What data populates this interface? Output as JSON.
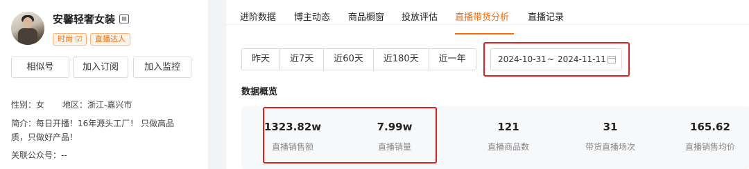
{
  "profile": {
    "shop_name": "安馨轻奢女装",
    "tags": [
      "时尚 ☑",
      "直播达人"
    ],
    "buttons": [
      "相似号",
      "加入订阅",
      "加入监控"
    ],
    "gender": "性别：女",
    "region": "地区：浙江-嘉兴市",
    "intro": "简介：每日开播！16年源头工厂！ 只做高品质，只做好产品！",
    "wechat": "关联公众号：--"
  },
  "tabs": [
    {
      "label": "进阶数据",
      "active": false
    },
    {
      "label": "博主动态",
      "active": false
    },
    {
      "label": "商品橱窗",
      "active": false
    },
    {
      "label": "投放评估",
      "active": false
    },
    {
      "label": "直播带货分析",
      "active": true
    },
    {
      "label": "直播记录",
      "active": false
    }
  ],
  "range_buttons": [
    "昨天",
    "近7天",
    "近60天",
    "近180天",
    "近一年"
  ],
  "date_range": {
    "start": "2024-10-31",
    "separator": "~",
    "end": "2024-11-11"
  },
  "section_title": "数据概览",
  "stats": [
    {
      "value": "1323.82w",
      "label": "直播销售额"
    },
    {
      "value": "7.99w",
      "label": "直播销量"
    },
    {
      "value": "121",
      "label": "直播商品数"
    },
    {
      "value": "31",
      "label": "带货直播场次"
    },
    {
      "value": "165.62",
      "label": "直播销售均价"
    }
  ],
  "colors": {
    "accent": "#ff6a00",
    "highlight": "#e02020"
  }
}
